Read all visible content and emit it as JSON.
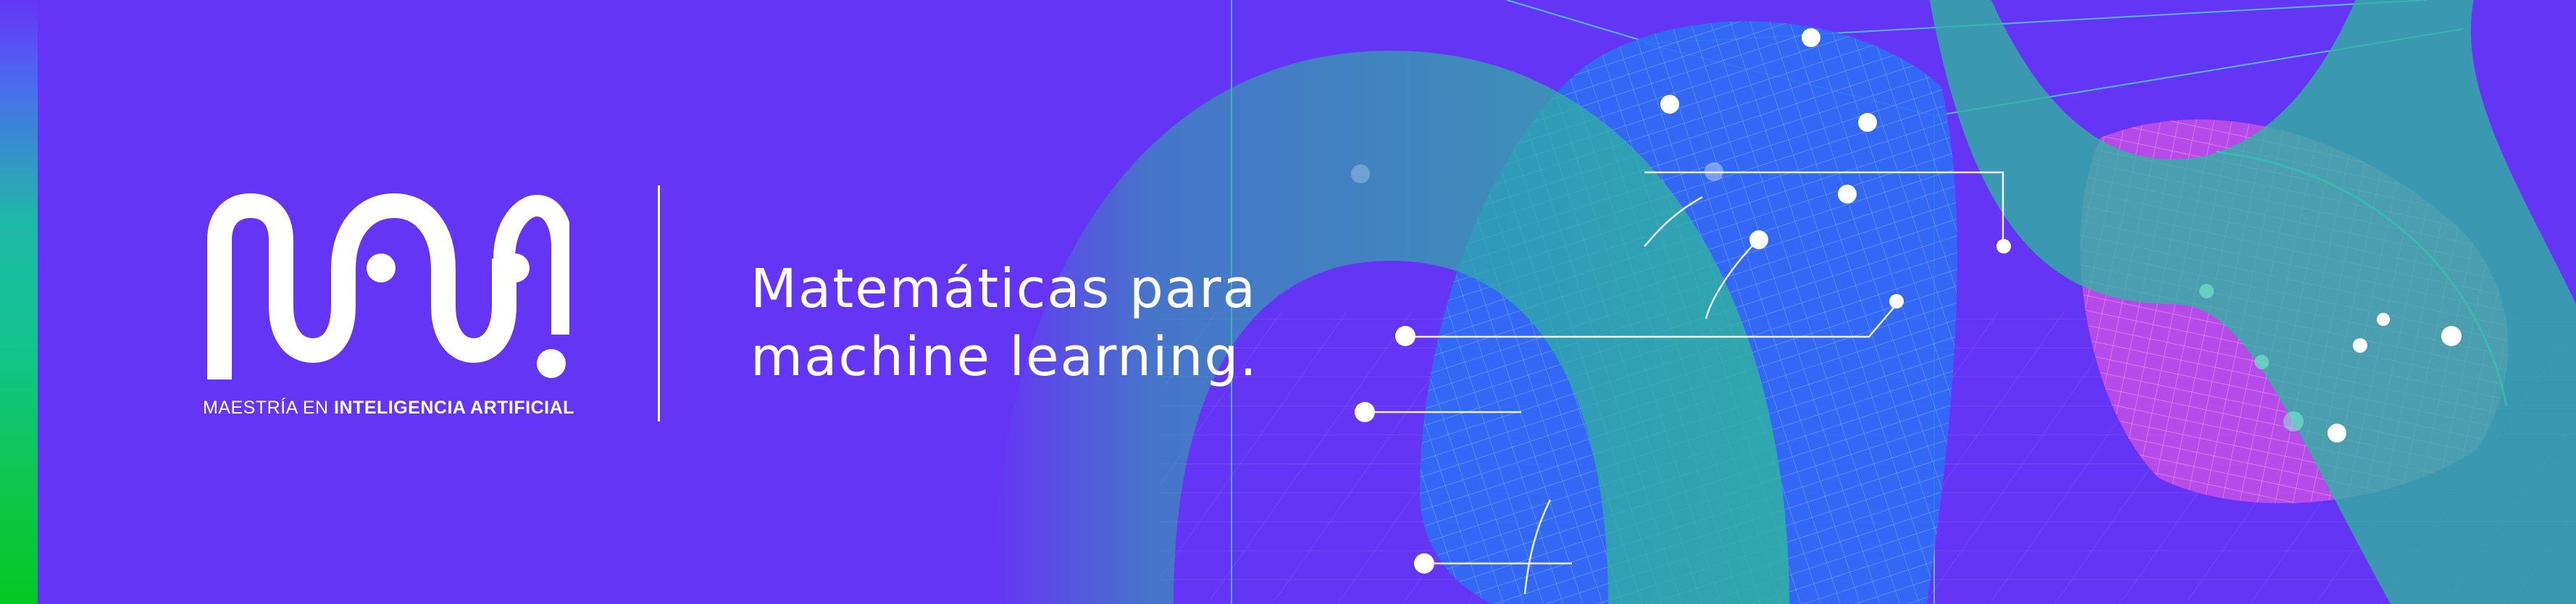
{
  "logo": {
    "caption_prefix": "MAESTRÍA EN ",
    "caption_emphasis": "INTELIGENCIA ARTIFICIAL"
  },
  "tagline": {
    "line1": "Matemáticas para",
    "line2": "machine learning."
  },
  "colors": {
    "background": "#6535f6",
    "accent_green": "#0fc653",
    "accent_teal": "#1fb7a8",
    "surface_blue": "#2f6bf5",
    "surface_magenta": "#c94be6",
    "text": "#ffffff"
  }
}
